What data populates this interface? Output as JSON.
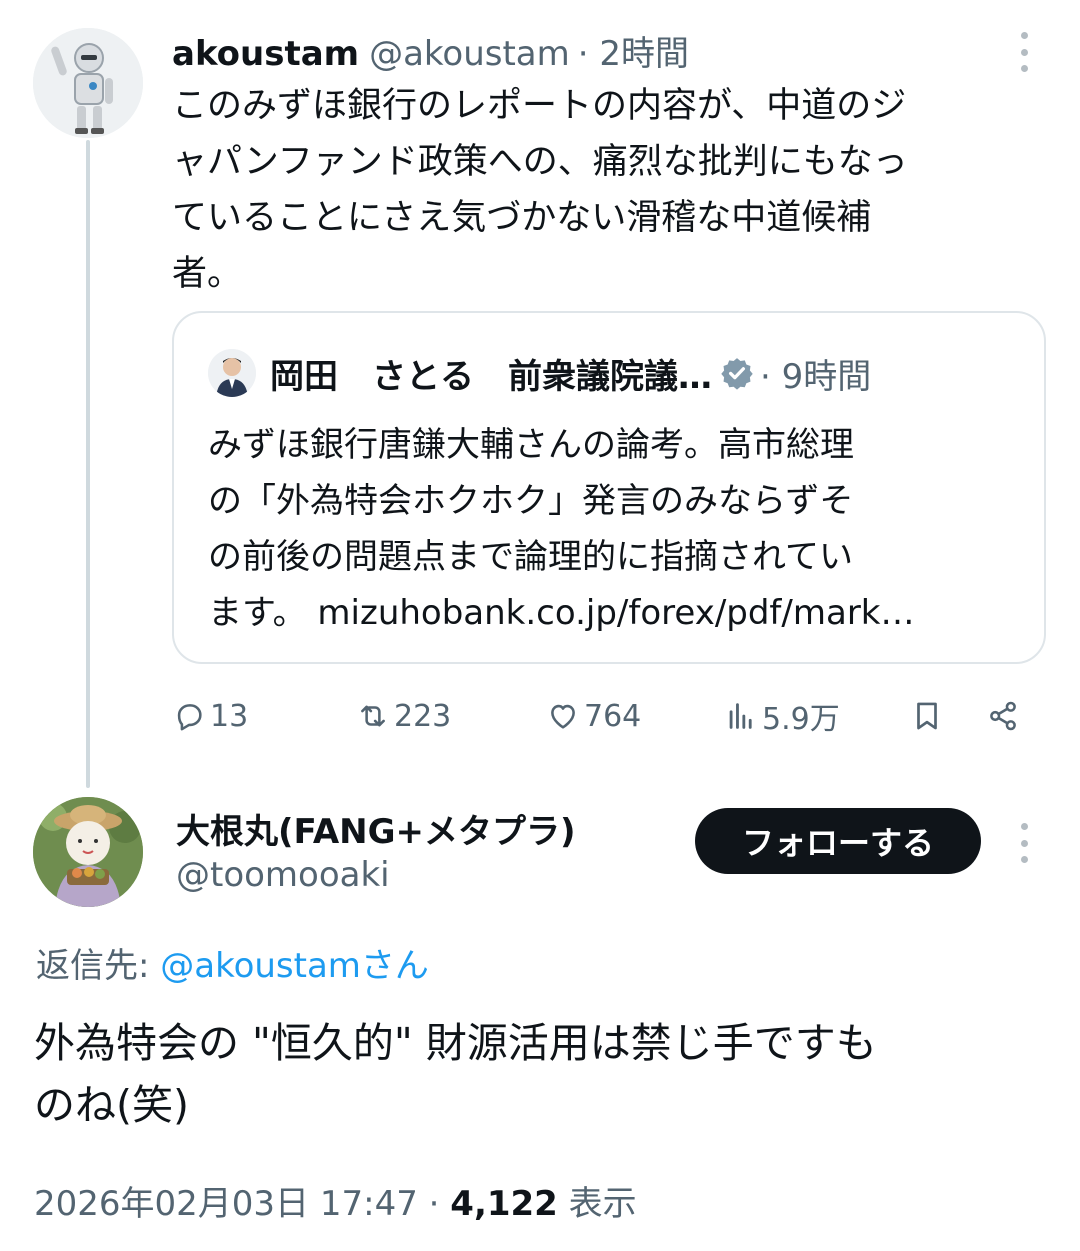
{
  "tweet1": {
    "name": "akoustam",
    "handle": "@akoustam",
    "time": "· 2時間",
    "body_lines": [
      "このみずほ銀行のレポートの内容が、中道のジ",
      "ャパンファンド政策への、痛烈な批判にもなっ",
      "ていることにさえ気づかない滑稽な中道候補",
      "者。"
    ],
    "quote": {
      "name": "岡田　さとる　前衆議院議…",
      "time": "· 9時間",
      "body_lines": [
        "みずほ銀行唐鎌大輔さんの論考。高市総理",
        "の「外為特会ホクホク」発言のみならずそ",
        "の前後の問題点まで論理的に指摘されてい",
        "ます。 mizuhobank.co.jp/forex/pdf/mark…"
      ]
    },
    "actions": {
      "replies": "13",
      "retweets": "223",
      "likes": "764",
      "views": "5.9万"
    }
  },
  "tweet2": {
    "name": "大根丸(FANG+メタプラ)",
    "handle": "@toomooaki",
    "follow_label": "フォローする",
    "reply_prefix": "返信先: ",
    "reply_mention": "@akoustamさん",
    "body_lines": [
      "外為特会の \"恒久的\" 財源活用は禁じ手ですも",
      "のね(笑)"
    ],
    "timestamp": "2026年02月03日 17:47 · ",
    "view_count": "4,122",
    "view_suffix": " 表示"
  },
  "icons": {
    "reply": "reply-icon",
    "retweet": "retweet-icon",
    "like": "heart-icon",
    "views": "views-icon",
    "bookmark": "bookmark-icon",
    "share": "share-icon",
    "more": "more-icon",
    "verified": "verified-badge-icon"
  },
  "colors": {
    "text": "#0f1419",
    "secondary": "#536471",
    "accent": "#1d9bf0",
    "border": "#dfe5e9",
    "verified_gray": "#829aab"
  }
}
